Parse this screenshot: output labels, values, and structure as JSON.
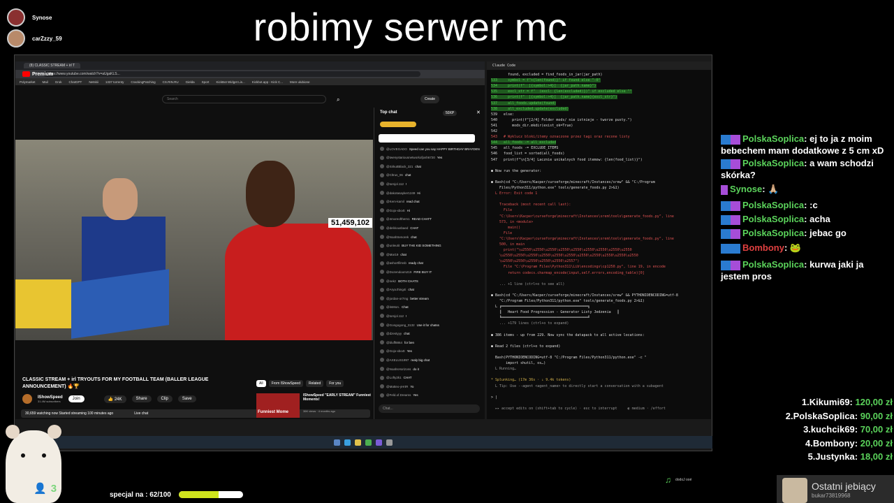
{
  "stream_title": "robimy serwer mc",
  "viewers_top": [
    {
      "name": "Synose"
    },
    {
      "name": "carZzzy_59"
    }
  ],
  "browser": {
    "tab_title": "(8) CLASSIC STREAM + irl T",
    "url": "https://www.youtube.com/watch?v=aUgaKLS...",
    "bookmarks": [
      "Polymarket",
      "Mail",
      "Grok",
      "ChatGPT",
      "Netskii",
      "1337 torrenty",
      "CrackingPatching",
      "CS.RIN.RU",
      "Gielda",
      "Sport",
      "KickBot Widget Lis...",
      "Kickbot.app - Kick C...",
      "More ulubione"
    ],
    "yt_brand": "Premium",
    "search_placeholder": "Search",
    "create_label": "Create",
    "view_counter": "51,459,102",
    "video_title": "CLASSIC STREAM + irl TRYOUTS FOR MY FOOTBALL TEAM (BALLER LEAGUE ANNOUNCEMENT) 🔥🏆",
    "channel": "IShowSpeed",
    "subscribers": "31.4M subscribers",
    "join_label": "Join",
    "likes": "24K",
    "share_label": "Share",
    "clip_label": "Clip",
    "save_label": "Save",
    "stats": "30,659 watching now Started streaming 100 minutes ago",
    "live_chat_label": "Live chat",
    "filters": [
      "All",
      "From IShowSpeed",
      "Related",
      "For you"
    ],
    "suggest_title": "IShowSpeed \"EARLY STREAM\" Funniest Moments!",
    "suggest_meta": "36K views · 4 months ago",
    "thumb_text": "Funniest Mome",
    "chat_header": "Top chat",
    "chat_pill": "50XP",
    "chat_input_placeholder": "Chat...",
    "chat_messages": [
      {
        "user": "@LOVEGADO",
        "msg": "Speed can you say HAPPY BIRTHDAY BRAYDEN"
      },
      {
        "user": "@twenystariousnetworkofjosh6720",
        "msg": "Yes"
      },
      {
        "user": "@SirkuttBlack_321",
        "msg": "chat"
      },
      {
        "user": "@Cltrus_06",
        "msg": "chat"
      },
      {
        "user": "@tomjol.112",
        "msg": "!"
      },
      {
        "user": "@dakotasayker1249",
        "msg": "Hi"
      },
      {
        "user": "@Kem-kamil",
        "msg": "read chat"
      },
      {
        "user": "@Gojo-xbo4t",
        "msg": "Hi"
      },
      {
        "user": "@4moreofthem1",
        "msg": "READ CHATT"
      },
      {
        "user": "@deliriousbaed",
        "msg": "CHAT"
      },
      {
        "user": "@NoahSenorek",
        "msg": "chat"
      },
      {
        "user": "@unleutit",
        "msg": "BUY THE KID SOMETHING"
      },
      {
        "user": "@Mar19",
        "msg": "chat"
      },
      {
        "user": "@ashortfilmsb",
        "msg": "ready chat"
      },
      {
        "user": "@Dozendoom219",
        "msg": "FIRE BUY IT"
      },
      {
        "user": "@nekz",
        "msg": "BOTH CHATS"
      },
      {
        "user": "@Arya.thing4i",
        "msg": "chat"
      },
      {
        "user": "@jordan-or7mg",
        "msg": "better stream"
      },
      {
        "user": "@itsMon.",
        "msg": "Chat"
      },
      {
        "user": "@tomjol.112",
        "msg": "!"
      },
      {
        "user": "@Gongogong_3132",
        "msg": "Use it for chatss"
      },
      {
        "user": "@dzestyyy",
        "msg": "chat"
      },
      {
        "user": "@bluff8864",
        "msg": "for ben"
      },
      {
        "user": "@Gojo-xbo4t",
        "msg": "Yes"
      },
      {
        "user": "@AXELUS1997",
        "msg": "realy big chat"
      },
      {
        "user": "@NoahsHorizons",
        "msg": "do it"
      },
      {
        "user": "@Lofty2k1",
        "msg": "CHAT"
      },
      {
        "user": "@Matteo-yHrtR",
        "msg": "Yo"
      },
      {
        "user": "@Feld.of.Dreams",
        "msg": "Yes"
      }
    ]
  },
  "terminal": {
    "tab_title": "Claude Code",
    "lines": [
      {
        "t": "        found, excluded = find_foods_in_jar(jar_path)",
        "c": "w"
      },
      {
        "t": "533     symbol = f\"+{len(found)}\" if found else \"-0\"",
        "c": "g"
      },
      {
        "t": "534     print(f\"  [{symbol:>4}]  {jar_path.name}\")",
        "c": "g"
      },
      {
        "t": "535     excl_str = f\"  (excl: {len(excluded)})\" if excluded else \"\"",
        "c": "g"
      },
      {
        "t": "536     print(f\"  [{symbol:>4}]  {jar_path.name}{excl_str}\")",
        "c": "g"
      },
      {
        "t": "537     all_foods.update(found)",
        "c": "g"
      },
      {
        "t": "538     all_excluded.update(excluded)",
        "c": "g"
      },
      {
        "t": "539   else:",
        "c": "w"
      },
      {
        "t": "540       print(f\"[2/4] Folder mods/ nie istnieje - tworze pusty.\")",
        "c": "w"
      },
      {
        "t": "541       mods_dir.mkdir(exist_ok=True)",
        "c": "w"
      },
      {
        "t": "542",
        "c": "w"
      },
      {
        "t": "543   # Wyklucz bloki/itemy oznaczone przez tagi oraz recone listy",
        "c": "r"
      },
      {
        "t": "544   all_foods -= all_excluded",
        "c": "g"
      },
      {
        "t": "545   all_foods -= EXCLUDE_ITEMS",
        "c": "w"
      },
      {
        "t": "546   food_list = sorted(all_foods)",
        "c": "w"
      },
      {
        "t": "547   print(f\"\\n[3/4] Lacznie unikalnych food itemow: {len(food_list)}\")",
        "c": "w"
      },
      {
        "t": "",
        "c": "w"
      },
      {
        "t": "● Now run the generator:",
        "c": "w"
      },
      {
        "t": "",
        "c": "w"
      },
      {
        "t": "● Bash(cd \"C:/Users/Kacper/curseforge/minecraft/Instances/srew\" && \"C:/Program",
        "c": "w"
      },
      {
        "t": "    Files/Python311/python.exe\" tools/generate_foods.py 2>&1)",
        "c": "w"
      },
      {
        "t": "  L Error: Exit code 1",
        "c": "r"
      },
      {
        "t": "",
        "c": "w"
      },
      {
        "t": "    Traceback (most recent call last):",
        "c": "r"
      },
      {
        "t": "      File",
        "c": "r"
      },
      {
        "t": "    \"C:\\Users\\Kacper\\curseforge\\minecraft\\Instances\\srem\\tools\\generate_foods.py\", line",
        "c": "r"
      },
      {
        "t": "    573, in <module>",
        "c": "r"
      },
      {
        "t": "        main()",
        "c": "r"
      },
      {
        "t": "      File",
        "c": "r"
      },
      {
        "t": "    \"C:\\Users\\Kacper\\curseforge\\minecraft\\Instances\\srem\\tools\\generate_foods.py\", line",
        "c": "r"
      },
      {
        "t": "    500, in main",
        "c": "r"
      },
      {
        "t": "      print(\"\\u2550\\u2550\\u2550\\u2550\\u2550\\u2550\\u2550\\u2550\\u2550",
        "c": "r"
      },
      {
        "t": "    \\u2550\\u2550\\u2550\\u2550\\u2550\\u2550\\u2550\\u2550\\u2550\\u2550\\u2550",
        "c": "r"
      },
      {
        "t": "    \\u2550\\u2550\\u2550\\u2550\\u2550\\u2557\")",
        "c": "r"
      },
      {
        "t": "      File \"C:\\Program Files\\Python311\\Lib\\encodings\\cp1250.py\", line 19, in encode",
        "c": "r"
      },
      {
        "t": "        return codecs.charmap_encode(input,self.errors,encoding_table)[0]",
        "c": "r"
      },
      {
        "t": "",
        "c": "w"
      },
      {
        "t": "    ... +1 line (ctrl+o to see all)",
        "c": "gr"
      },
      {
        "t": "",
        "c": "w"
      },
      {
        "t": "● Bash(cd \"C:/Users/Kacper/curseforge/minecraft/Instances/srew\" && PYTHONIOENCODING=utf-8",
        "c": "w"
      },
      {
        "t": "    \"C:/Program Files/Python311/python.exe\" tools/generate_foods.py 2>&1)",
        "c": "w"
      },
      {
        "t": "  L ╔═════════════════════════════════════════╗",
        "c": "w"
      },
      {
        "t": "    ║   Heart Food Progression - Generator Listy Jedzenia   ║",
        "c": "w"
      },
      {
        "t": "    ╚═════════════════════════════════════════╝",
        "c": "w"
      },
      {
        "t": "    ... +179 lines (ctrl+o to expand)",
        "c": "gr"
      },
      {
        "t": "",
        "c": "w"
      },
      {
        "t": "● 386 items - up from 229. Now sync the datapack to all active locations:",
        "c": "w"
      },
      {
        "t": "",
        "c": "w"
      },
      {
        "t": "● Read 2 files (ctrl+o to expand)",
        "c": "w"
      },
      {
        "t": "",
        "c": "w"
      },
      {
        "t": "  Bash(PYTHONIOENCODING=utf-8 \"C:/Program Files/Python311/python.exe\" -c \"",
        "c": "w"
      },
      {
        "t": "       import shutil, os…)",
        "c": "w"
      },
      {
        "t": "  L Running…",
        "c": "gr"
      },
      {
        "t": "",
        "c": "w"
      },
      {
        "t": "* Splunking… (17m 36s · ↓ 9.4k tokens)",
        "c": "y"
      },
      {
        "t": "  L Tip: Use --agent <agent_name> to directly start a conversation with a subagent",
        "c": "gr"
      },
      {
        "t": "",
        "c": "w"
      },
      {
        "t": "> |",
        "c": "w"
      },
      {
        "t": "",
        "c": "w"
      },
      {
        "t": "  ▸▸ accept edits on (shift+tab to cycle) · esc to interrupt     ◐ medium · /effort",
        "c": "gr"
      }
    ]
  },
  "side_chat": [
    {
      "user": "PolskaSoplica",
      "msg": "ej to ja z moim bebechem mam dodatkowe z 5 cm xD"
    },
    {
      "user": "PolskaSoplica",
      "msg": "a wam schodzi skórka?"
    },
    {
      "user": "Synose",
      "msg": "🙏🏼"
    },
    {
      "user": "PolskaSoplica",
      "msg": ":c"
    },
    {
      "user": "PolskaSoplica",
      "msg": "acha"
    },
    {
      "user": "PolskaSoplica",
      "msg": "jebac go"
    },
    {
      "user": "Bombony",
      "msg": "🐸"
    },
    {
      "user": "PolskaSoplica",
      "msg": "kurwa jaki ja jestem pros"
    }
  ],
  "leaderboard": [
    {
      "rank": "1.",
      "name": "Kikumi69:",
      "amount": "120,00 zł"
    },
    {
      "rank": "2.",
      "name": "PolskaSoplica:",
      "amount": "90,00 zł"
    },
    {
      "rank": "3.",
      "name": "kuchcik69:",
      "amount": "70,00 zł"
    },
    {
      "rank": "4.",
      "name": "Bombony:",
      "amount": "20,00 zł"
    },
    {
      "rank": "5.",
      "name": "Justynka:",
      "amount": "18,00 zł"
    }
  ],
  "specjal_label": "specjal na : 62/100",
  "specjal_progress": 0.62,
  "viewer_count": "3",
  "last_donor_title": "Ostatni jebiący",
  "last_donor_name": "bukar73819968",
  "now_playing": "dodoJ ooé",
  "colors": {
    "accent_green": "#5bd35b",
    "progress": "#cfe41d",
    "terminal_green": "#4ec94e",
    "terminal_red": "#e05252"
  }
}
